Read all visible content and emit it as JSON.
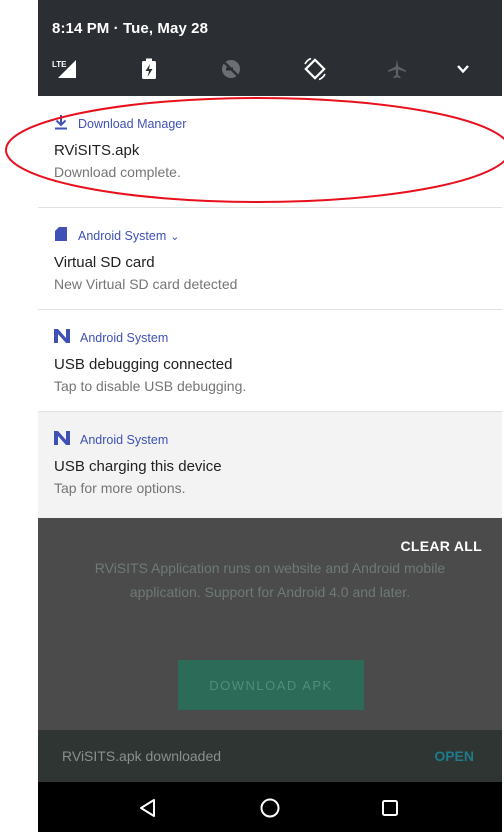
{
  "status": {
    "time_date": "8:14 PM · Tue, May 28",
    "network_label": "LTE"
  },
  "quick_settings": {
    "icons": [
      "lte-signal-icon",
      "battery-saver-icon",
      "do-not-disturb-icon",
      "auto-rotate-icon",
      "airplane-mode-icon",
      "expand-chevron-icon"
    ]
  },
  "notifications": [
    {
      "app": "Download Manager",
      "icon": "download-icon",
      "title": "RViSITS.apk",
      "text": "Download complete."
    },
    {
      "app": "Android System",
      "icon": "sd-card-icon",
      "expand": "⌄",
      "title": "Virtual SD card",
      "text": "New Virtual SD card detected"
    },
    {
      "app": "Android System",
      "icon": "android-n-icon",
      "title": "USB debugging connected",
      "text": "Tap to disable USB debugging."
    },
    {
      "app": "Android System",
      "icon": "android-n-icon",
      "title": "USB charging this device",
      "text": "Tap for more options."
    }
  ],
  "clear_all_label": "CLEAR ALL",
  "background_app": {
    "description": "RViSITS Application runs on website and Android mobile application. Support for Android 4.0 and later.",
    "download_button": "DOWNLOAD APK",
    "snackbar_message": "RViSITS.apk downloaded",
    "snackbar_action": "OPEN"
  },
  "navbar": {
    "icons": [
      "back-icon",
      "home-icon",
      "recents-icon"
    ]
  },
  "colors": {
    "accent_link": "#3f51b5",
    "annotation": "#e8101c",
    "qs_background": "#2b2f33"
  }
}
